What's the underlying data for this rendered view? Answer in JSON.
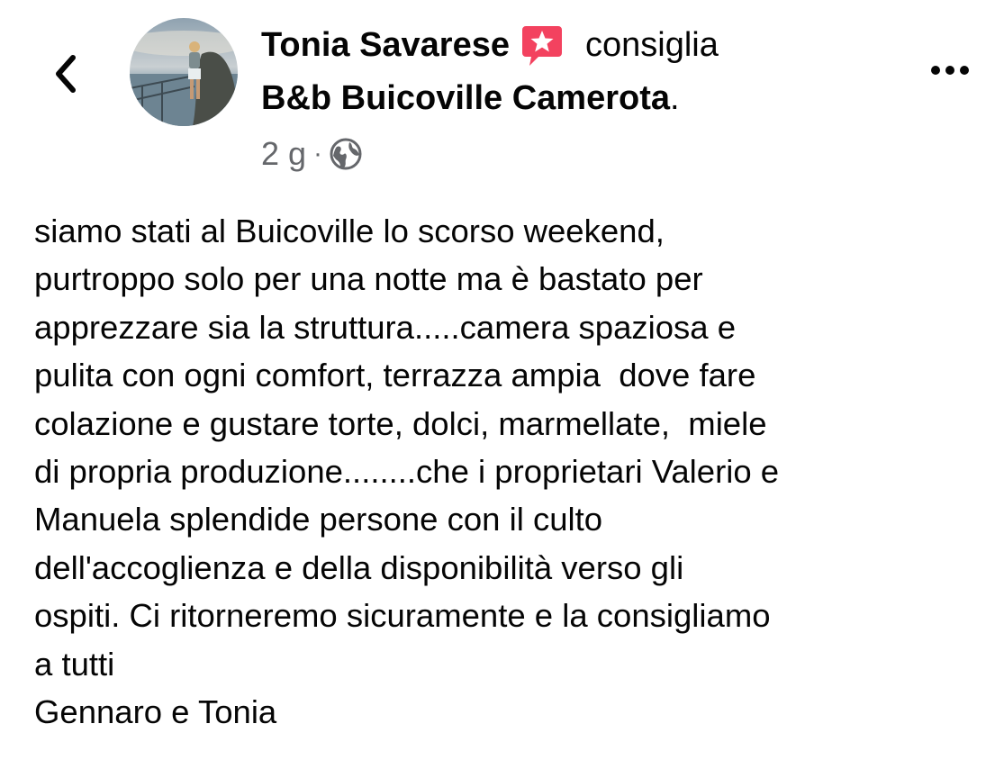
{
  "header": {
    "author_name": "Tonia Savarese",
    "verb": "consiglia",
    "page_name": "B&b Buicoville Camerota",
    "page_suffix": ".",
    "timestamp": "2 g",
    "separator": "·",
    "privacy_icon": "globe-icon",
    "badge_icon": "recommendation-star-icon",
    "back_icon": "chevron-left-icon",
    "more_icon": "more-horizontal-icon"
  },
  "post": {
    "lines": [
      "siamo stati al Buicoville lo scorso weekend,",
      "purtroppo solo per una notte ma è bastato per",
      "apprezzare sia la struttura.....camera spaziosa e",
      "pulita con ogni comfort, terrazza ampia  dove fare",
      "colazione e gustare torte, dolci, marmellate,  miele",
      "di propria produzione........che i proprietari Valerio e",
      "Manuela splendide persone con il culto",
      "dell'accoglienza e della disponibilità verso gli",
      "ospiti. Ci ritorneremo sicuramente e la consigliamo",
      "a tutti",
      "Gennaro e Tonia"
    ]
  },
  "colors": {
    "text": "#050505",
    "secondary_text": "#65676b",
    "badge_red": "#f3425f"
  }
}
